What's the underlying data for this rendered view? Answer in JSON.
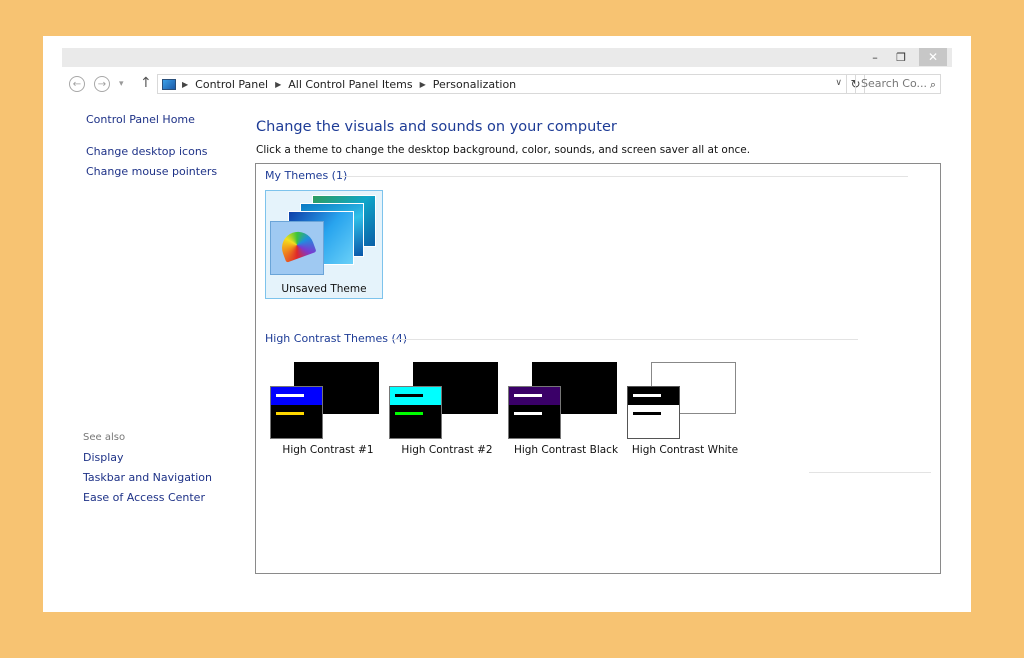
{
  "window": {
    "minimize": "–",
    "maximize": "❐",
    "close": "✕"
  },
  "nav": {
    "back_icon": "←",
    "forward_icon": "→",
    "history_icon": "▾",
    "up_icon": "↑",
    "breadcrumb": [
      "Control Panel",
      "All Control Panel Items",
      "Personalization"
    ],
    "separator": "▶",
    "dropdown_icon": "∨",
    "refresh_icon": "↻",
    "search_placeholder": "Search Co...",
    "search_icon": "⌕"
  },
  "sidebar": {
    "home": "Control Panel Home",
    "links": [
      "Change desktop icons",
      "Change mouse pointers"
    ],
    "see_also_title": "See also",
    "see_also": [
      "Display",
      "Taskbar and Navigation",
      "Ease of Access Center"
    ]
  },
  "main": {
    "heading": "Change the visuals and sounds on your computer",
    "subtext": "Click a theme to change the desktop background, color, sounds, and screen saver all at once.",
    "my_themes_title": "My Themes (1)",
    "my_themes": [
      {
        "label": "Unsaved Theme",
        "selected": true
      }
    ],
    "hc_title": "High Contrast Themes (4)",
    "hc_themes": [
      {
        "label": "High Contrast #1",
        "header_color": "#0000ff",
        "accent": "#ffd800",
        "back": "#000000",
        "front": "#000000"
      },
      {
        "label": "High Contrast #2",
        "header_color": "#00ffff",
        "accent": "#00ff00",
        "back": "#000000",
        "front": "#000000"
      },
      {
        "label": "High Contrast Black",
        "header_color": "#3a0068",
        "accent": "#ffffff",
        "back": "#000000",
        "front": "#000000"
      },
      {
        "label": "High Contrast White",
        "header_color": "#000000",
        "accent": "#000000",
        "back": "#ffffff",
        "front": "#ffffff"
      }
    ]
  }
}
